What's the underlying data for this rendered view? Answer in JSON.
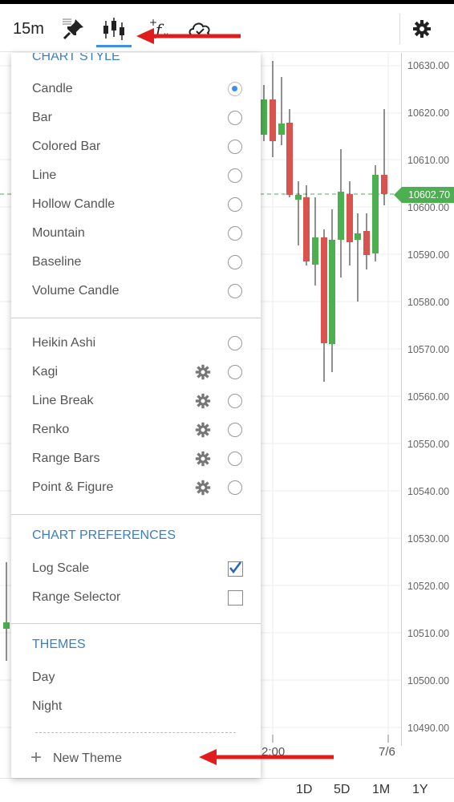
{
  "toolbar": {
    "interval": "15m",
    "icons": [
      "pin-icon",
      "candlestick-chart-icon",
      "function-icon",
      "cloud-check-icon",
      "gear-icon"
    ],
    "accent_color": "#3c8ee6"
  },
  "chart": {
    "price_labels": [
      "10630.00",
      "10620.00",
      "10610.00",
      "10600.00",
      "10590.00",
      "10580.00",
      "10570.00",
      "10560.00",
      "10550.00",
      "10540.00",
      "10530.00",
      "10520.00",
      "10510.00",
      "10500.00",
      "10490.00"
    ],
    "current_price": "10602.70",
    "time_labels": [
      "2:00",
      "7/6"
    ],
    "up_color": "#4caf50",
    "down_color": "#d9534f"
  },
  "menu": {
    "chart_style_title": "CHART STYLE",
    "chart_styles": [
      {
        "label": "Candle",
        "selected": true
      },
      {
        "label": "Bar",
        "selected": false
      },
      {
        "label": "Colored Bar",
        "selected": false
      },
      {
        "label": "Line",
        "selected": false
      },
      {
        "label": "Hollow Candle",
        "selected": false
      },
      {
        "label": "Mountain",
        "selected": false
      },
      {
        "label": "Baseline",
        "selected": false
      },
      {
        "label": "Volume Candle",
        "selected": false
      }
    ],
    "aggregations": [
      {
        "label": "Heikin Ashi",
        "has_settings": false
      },
      {
        "label": "Kagi",
        "has_settings": true
      },
      {
        "label": "Line Break",
        "has_settings": true
      },
      {
        "label": "Renko",
        "has_settings": true
      },
      {
        "label": "Range Bars",
        "has_settings": true
      },
      {
        "label": "Point & Figure",
        "has_settings": true
      }
    ],
    "preferences_title": "CHART PREFERENCES",
    "preferences": [
      {
        "label": "Log Scale",
        "checked": true
      },
      {
        "label": "Range Selector",
        "checked": false
      }
    ],
    "themes_title": "THEMES",
    "themes": [
      "Day",
      "Night"
    ],
    "new_theme_label": "New Theme"
  },
  "footer": {
    "ranges": [
      "1D",
      "5D",
      "1M",
      "1Y"
    ]
  }
}
